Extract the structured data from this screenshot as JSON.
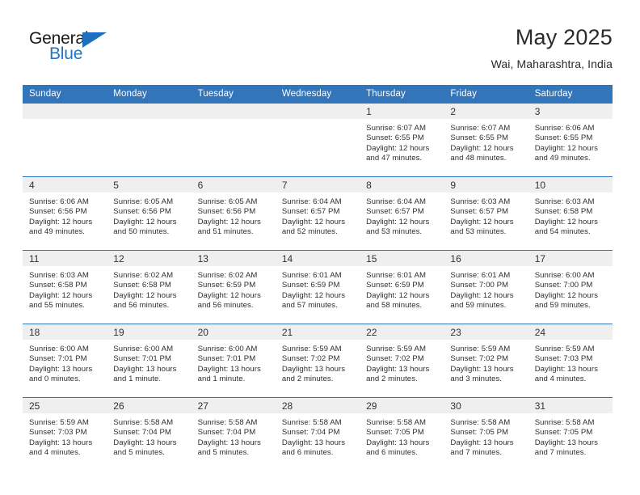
{
  "brand": {
    "name_top": "General",
    "name_bottom": "Blue",
    "triangle_color": "#1f6fc0",
    "text_color": "#1a1a1a",
    "blue_color": "#2275c3"
  },
  "header": {
    "title": "May 2025",
    "subtitle": "Wai, Maharashtra, India"
  },
  "theme": {
    "header_bg": "#3275bb",
    "header_text": "#ffffff",
    "daynum_band_bg": "#efefef",
    "row_divider": "#3275bb",
    "body_text": "#2f2f2f"
  },
  "weekday_headers": [
    "Sunday",
    "Monday",
    "Tuesday",
    "Wednesday",
    "Thursday",
    "Friday",
    "Saturday"
  ],
  "weeks": [
    [
      {
        "day": "",
        "empty": true,
        "sunrise": "",
        "sunset": "",
        "daylight_line1": "",
        "daylight_line2": ""
      },
      {
        "day": "",
        "empty": true,
        "sunrise": "",
        "sunset": "",
        "daylight_line1": "",
        "daylight_line2": ""
      },
      {
        "day": "",
        "empty": true,
        "sunrise": "",
        "sunset": "",
        "daylight_line1": "",
        "daylight_line2": ""
      },
      {
        "day": "",
        "empty": true,
        "sunrise": "",
        "sunset": "",
        "daylight_line1": "",
        "daylight_line2": ""
      },
      {
        "day": "1",
        "empty": false,
        "sunrise": "Sunrise: 6:07 AM",
        "sunset": "Sunset: 6:55 PM",
        "daylight_line1": "Daylight: 12 hours",
        "daylight_line2": "and 47 minutes."
      },
      {
        "day": "2",
        "empty": false,
        "sunrise": "Sunrise: 6:07 AM",
        "sunset": "Sunset: 6:55 PM",
        "daylight_line1": "Daylight: 12 hours",
        "daylight_line2": "and 48 minutes."
      },
      {
        "day": "3",
        "empty": false,
        "sunrise": "Sunrise: 6:06 AM",
        "sunset": "Sunset: 6:55 PM",
        "daylight_line1": "Daylight: 12 hours",
        "daylight_line2": "and 49 minutes."
      }
    ],
    [
      {
        "day": "4",
        "empty": false,
        "sunrise": "Sunrise: 6:06 AM",
        "sunset": "Sunset: 6:56 PM",
        "daylight_line1": "Daylight: 12 hours",
        "daylight_line2": "and 49 minutes."
      },
      {
        "day": "5",
        "empty": false,
        "sunrise": "Sunrise: 6:05 AM",
        "sunset": "Sunset: 6:56 PM",
        "daylight_line1": "Daylight: 12 hours",
        "daylight_line2": "and 50 minutes."
      },
      {
        "day": "6",
        "empty": false,
        "sunrise": "Sunrise: 6:05 AM",
        "sunset": "Sunset: 6:56 PM",
        "daylight_line1": "Daylight: 12 hours",
        "daylight_line2": "and 51 minutes."
      },
      {
        "day": "7",
        "empty": false,
        "sunrise": "Sunrise: 6:04 AM",
        "sunset": "Sunset: 6:57 PM",
        "daylight_line1": "Daylight: 12 hours",
        "daylight_line2": "and 52 minutes."
      },
      {
        "day": "8",
        "empty": false,
        "sunrise": "Sunrise: 6:04 AM",
        "sunset": "Sunset: 6:57 PM",
        "daylight_line1": "Daylight: 12 hours",
        "daylight_line2": "and 53 minutes."
      },
      {
        "day": "9",
        "empty": false,
        "sunrise": "Sunrise: 6:03 AM",
        "sunset": "Sunset: 6:57 PM",
        "daylight_line1": "Daylight: 12 hours",
        "daylight_line2": "and 53 minutes."
      },
      {
        "day": "10",
        "empty": false,
        "sunrise": "Sunrise: 6:03 AM",
        "sunset": "Sunset: 6:58 PM",
        "daylight_line1": "Daylight: 12 hours",
        "daylight_line2": "and 54 minutes."
      }
    ],
    [
      {
        "day": "11",
        "empty": false,
        "sunrise": "Sunrise: 6:03 AM",
        "sunset": "Sunset: 6:58 PM",
        "daylight_line1": "Daylight: 12 hours",
        "daylight_line2": "and 55 minutes."
      },
      {
        "day": "12",
        "empty": false,
        "sunrise": "Sunrise: 6:02 AM",
        "sunset": "Sunset: 6:58 PM",
        "daylight_line1": "Daylight: 12 hours",
        "daylight_line2": "and 56 minutes."
      },
      {
        "day": "13",
        "empty": false,
        "sunrise": "Sunrise: 6:02 AM",
        "sunset": "Sunset: 6:59 PM",
        "daylight_line1": "Daylight: 12 hours",
        "daylight_line2": "and 56 minutes."
      },
      {
        "day": "14",
        "empty": false,
        "sunrise": "Sunrise: 6:01 AM",
        "sunset": "Sunset: 6:59 PM",
        "daylight_line1": "Daylight: 12 hours",
        "daylight_line2": "and 57 minutes."
      },
      {
        "day": "15",
        "empty": false,
        "sunrise": "Sunrise: 6:01 AM",
        "sunset": "Sunset: 6:59 PM",
        "daylight_line1": "Daylight: 12 hours",
        "daylight_line2": "and 58 minutes."
      },
      {
        "day": "16",
        "empty": false,
        "sunrise": "Sunrise: 6:01 AM",
        "sunset": "Sunset: 7:00 PM",
        "daylight_line1": "Daylight: 12 hours",
        "daylight_line2": "and 59 minutes."
      },
      {
        "day": "17",
        "empty": false,
        "sunrise": "Sunrise: 6:00 AM",
        "sunset": "Sunset: 7:00 PM",
        "daylight_line1": "Daylight: 12 hours",
        "daylight_line2": "and 59 minutes."
      }
    ],
    [
      {
        "day": "18",
        "empty": false,
        "sunrise": "Sunrise: 6:00 AM",
        "sunset": "Sunset: 7:01 PM",
        "daylight_line1": "Daylight: 13 hours",
        "daylight_line2": "and 0 minutes."
      },
      {
        "day": "19",
        "empty": false,
        "sunrise": "Sunrise: 6:00 AM",
        "sunset": "Sunset: 7:01 PM",
        "daylight_line1": "Daylight: 13 hours",
        "daylight_line2": "and 1 minute."
      },
      {
        "day": "20",
        "empty": false,
        "sunrise": "Sunrise: 6:00 AM",
        "sunset": "Sunset: 7:01 PM",
        "daylight_line1": "Daylight: 13 hours",
        "daylight_line2": "and 1 minute."
      },
      {
        "day": "21",
        "empty": false,
        "sunrise": "Sunrise: 5:59 AM",
        "sunset": "Sunset: 7:02 PM",
        "daylight_line1": "Daylight: 13 hours",
        "daylight_line2": "and 2 minutes."
      },
      {
        "day": "22",
        "empty": false,
        "sunrise": "Sunrise: 5:59 AM",
        "sunset": "Sunset: 7:02 PM",
        "daylight_line1": "Daylight: 13 hours",
        "daylight_line2": "and 2 minutes."
      },
      {
        "day": "23",
        "empty": false,
        "sunrise": "Sunrise: 5:59 AM",
        "sunset": "Sunset: 7:02 PM",
        "daylight_line1": "Daylight: 13 hours",
        "daylight_line2": "and 3 minutes."
      },
      {
        "day": "24",
        "empty": false,
        "sunrise": "Sunrise: 5:59 AM",
        "sunset": "Sunset: 7:03 PM",
        "daylight_line1": "Daylight: 13 hours",
        "daylight_line2": "and 4 minutes."
      }
    ],
    [
      {
        "day": "25",
        "empty": false,
        "sunrise": "Sunrise: 5:59 AM",
        "sunset": "Sunset: 7:03 PM",
        "daylight_line1": "Daylight: 13 hours",
        "daylight_line2": "and 4 minutes."
      },
      {
        "day": "26",
        "empty": false,
        "sunrise": "Sunrise: 5:58 AM",
        "sunset": "Sunset: 7:04 PM",
        "daylight_line1": "Daylight: 13 hours",
        "daylight_line2": "and 5 minutes."
      },
      {
        "day": "27",
        "empty": false,
        "sunrise": "Sunrise: 5:58 AM",
        "sunset": "Sunset: 7:04 PM",
        "daylight_line1": "Daylight: 13 hours",
        "daylight_line2": "and 5 minutes."
      },
      {
        "day": "28",
        "empty": false,
        "sunrise": "Sunrise: 5:58 AM",
        "sunset": "Sunset: 7:04 PM",
        "daylight_line1": "Daylight: 13 hours",
        "daylight_line2": "and 6 minutes."
      },
      {
        "day": "29",
        "empty": false,
        "sunrise": "Sunrise: 5:58 AM",
        "sunset": "Sunset: 7:05 PM",
        "daylight_line1": "Daylight: 13 hours",
        "daylight_line2": "and 6 minutes."
      },
      {
        "day": "30",
        "empty": false,
        "sunrise": "Sunrise: 5:58 AM",
        "sunset": "Sunset: 7:05 PM",
        "daylight_line1": "Daylight: 13 hours",
        "daylight_line2": "and 7 minutes."
      },
      {
        "day": "31",
        "empty": false,
        "sunrise": "Sunrise: 5:58 AM",
        "sunset": "Sunset: 7:05 PM",
        "daylight_line1": "Daylight: 13 hours",
        "daylight_line2": "and 7 minutes."
      }
    ]
  ]
}
